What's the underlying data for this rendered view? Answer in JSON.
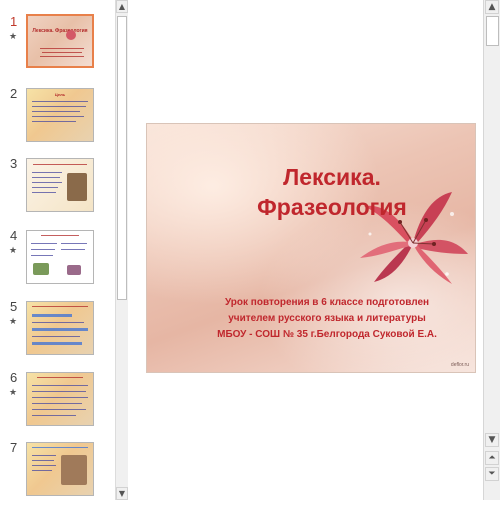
{
  "thumbnails": [
    {
      "number": "1",
      "has_star": true,
      "active": true,
      "title": "Лексика. Фразеология",
      "style": "rose"
    },
    {
      "number": "2",
      "has_star": false,
      "active": false,
      "title": "Цель",
      "style": "warm"
    },
    {
      "number": "3",
      "has_star": false,
      "active": false,
      "title": "",
      "style": "pale"
    },
    {
      "number": "4",
      "has_star": true,
      "active": false,
      "title": "",
      "style": "white"
    },
    {
      "number": "5",
      "has_star": true,
      "active": false,
      "title": "",
      "style": "warm"
    },
    {
      "number": "6",
      "has_star": true,
      "active": false,
      "title": "",
      "style": "warm"
    },
    {
      "number": "7",
      "has_star": false,
      "active": false,
      "title": "",
      "style": "warm"
    }
  ],
  "slide": {
    "title_line1": "Лексика.",
    "title_line2": "Фразеология",
    "subtitle_line1": "Урок повторения в 6 классе подготовлен",
    "subtitle_line2": "учителем русского языка и литературы",
    "subtitle_line3": "МБОУ - СОШ № 35 г.Белгорода Суковой Е.А.",
    "watermark": "deflor.ru"
  },
  "icons": {
    "star": "★",
    "scroll_up": "▲",
    "scroll_down": "▼",
    "prev_slide": "⏶",
    "next_slide": "⏷"
  },
  "colors": {
    "title_red": "#c0272d",
    "active_border": "#e8804a"
  }
}
